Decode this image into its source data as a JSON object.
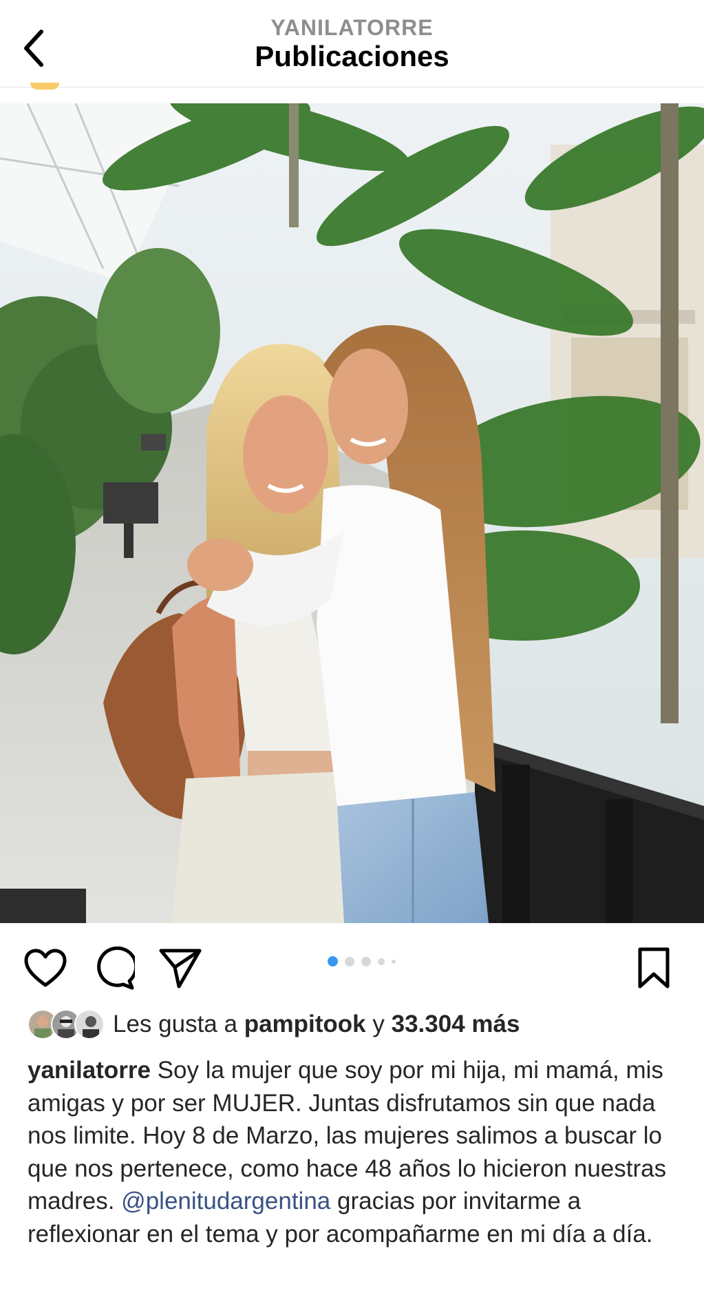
{
  "header": {
    "username_caps": "YANILATORRE",
    "title": "Publicaciones"
  },
  "post": {
    "carousel": {
      "count": 5,
      "active_index": 0
    },
    "likes": {
      "prefix": "Les gusta a",
      "first_user": "pampitook",
      "connector": "y",
      "count_text": "33.304 más"
    },
    "caption": {
      "author": "yanilatorre",
      "text_before": "Soy la mujer que soy por mi hija, mi mamá, mis amigas y por ser MUJER. Juntas disfrutamos sin que nada nos limite. Hoy 8 de Marzo, las mujeres salimos a buscar lo que nos pertenece, como hace 48 años lo hicieron nuestras madres.",
      "mention": "@plenitudargentina",
      "text_after": "gracias por invitarme a reflexionar en el tema y por acompañarme en mi día a día."
    }
  },
  "colors": {
    "accent_blue": "#3897f0",
    "mention": "#385185",
    "text": "#262626",
    "muted": "#8e8e8e"
  },
  "icons": {
    "back": "chevron-left-icon",
    "like": "heart-icon",
    "comment": "comment-bubble-icon",
    "share": "paper-plane-icon",
    "save": "bookmark-icon"
  }
}
